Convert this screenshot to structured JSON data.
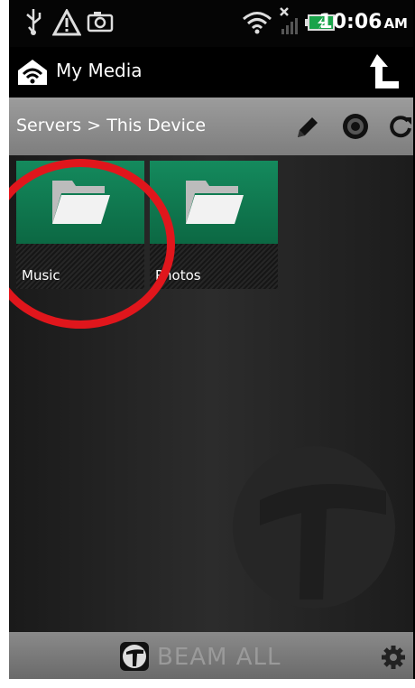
{
  "status_bar": {
    "time": "10:06",
    "ampm": "AM",
    "icons": [
      "usb-icon",
      "warning-icon",
      "camera-icon",
      "wifi-icon",
      "signal-icon",
      "battery-charging-icon"
    ]
  },
  "header": {
    "title": "My Media",
    "app_icon": "home-wifi-icon",
    "up_icon": "up-arrow-icon"
  },
  "breadcrumb": {
    "text": "Servers > This Device",
    "actions": [
      "pencil-icon",
      "globe-icon",
      "refresh-icon"
    ]
  },
  "folders": [
    {
      "label": "Music",
      "icon": "folder-icon"
    },
    {
      "label": "Photos",
      "icon": "folder-icon"
    }
  ],
  "annotation": {
    "type": "red-circle",
    "target": "Music",
    "color": "#e0161c"
  },
  "footer": {
    "beam_all_label": "BEAM ALL",
    "beam_icon": "beam-logo-icon",
    "settings_icon": "gear-icon"
  },
  "colors": {
    "folder_green": "#0e6b46",
    "bar_gray": "#8a8a8a",
    "highlight_red": "#e0161c"
  }
}
